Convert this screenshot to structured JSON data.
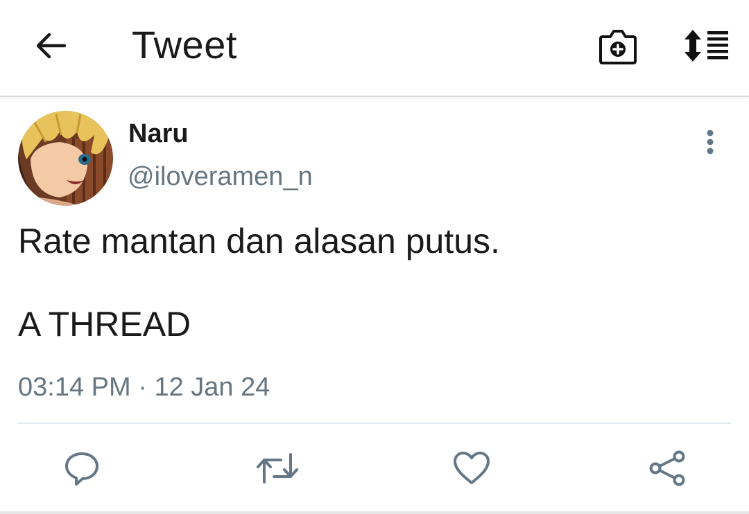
{
  "appbar": {
    "title": "Tweet",
    "back_icon": "arrow-left-icon",
    "camera_icon": "camera-add-icon",
    "sort_icon": "sort-list-icon"
  },
  "tweet": {
    "display_name": "Naru",
    "handle": "@iloveramen_n",
    "text_line1": "Rate mantan dan alasan putus.",
    "text_line2": "A THREAD",
    "time": "03:14 PM",
    "separator": " · ",
    "date": "12 Jan 24"
  },
  "actions": {
    "reply_icon": "reply-icon",
    "retweet_icon": "retweet-icon",
    "like_icon": "heart-icon",
    "share_icon": "share-icon"
  },
  "colors": {
    "text": "#1a1a1a",
    "secondary": "#66757f",
    "icon": "#657786",
    "divider": "#e1e8ed"
  }
}
